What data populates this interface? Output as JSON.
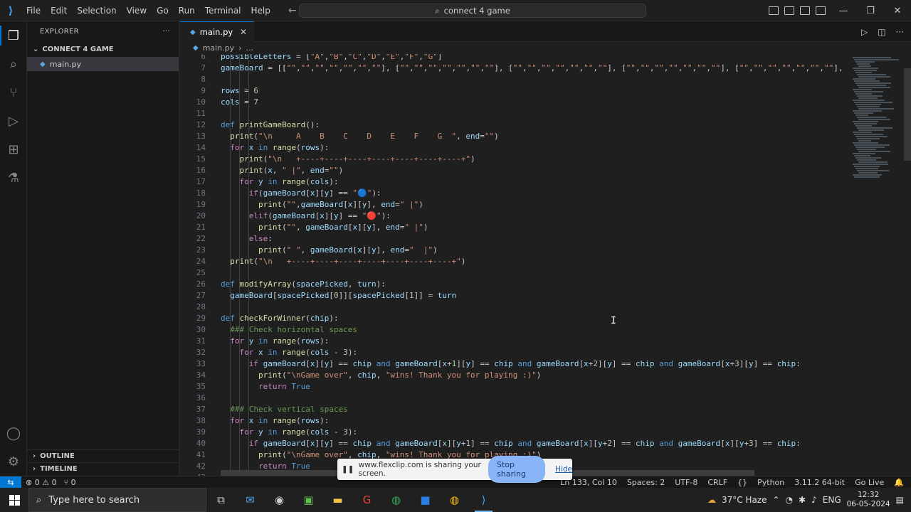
{
  "titlebar": {
    "menu": [
      "File",
      "Edit",
      "Selection",
      "View",
      "Go",
      "Run",
      "Terminal",
      "Help"
    ],
    "search_text": "connect 4 game"
  },
  "sidebar": {
    "title": "EXPLORER",
    "folder": "CONNECT 4 GAME",
    "file": "main.py",
    "outline": "OUTLINE",
    "timeline": "TIMELINE"
  },
  "tab": {
    "label": "main.py"
  },
  "breadcrumb": {
    "file": "main.py",
    "rest": "..."
  },
  "code_lines": [
    {
      "n": "6",
      "t": "possibleLetters = [\"A\",\"B\",\"C\",\"D\",\"E\",\"F\",\"G\"]"
    },
    {
      "n": "7",
      "t": "gameBoard = [[\"\",\"\",\"\",\"\",\"\",\"\",\"\"], [\"\",\"\",\"\",\"\",\"\",\"\",\"\"], [\"\",\"\",\"\",\"\",\"\",\"\",\"\"], [\"\",\"\",\"\",\"\",\"\",\"\",\"\"], [\"\",\"\",\"\",\"\",\"\",\"\",\"\"], [\"\","
    },
    {
      "n": "8",
      "t": ""
    },
    {
      "n": "9",
      "t": "rows = 6"
    },
    {
      "n": "10",
      "t": "cols = 7"
    },
    {
      "n": "11",
      "t": ""
    },
    {
      "n": "12",
      "t": "def printGameBoard():"
    },
    {
      "n": "13",
      "t": "  print(\"\\n     A    B    C    D    E    F    G  \", end=\"\")"
    },
    {
      "n": "14",
      "t": "  for x in range(rows):"
    },
    {
      "n": "15",
      "t": "    print(\"\\n   +----+----+----+----+----+----+----+\")"
    },
    {
      "n": "16",
      "t": "    print(x, \" |\", end=\"\")"
    },
    {
      "n": "17",
      "t": "    for y in range(cols):"
    },
    {
      "n": "18",
      "t": "      if(gameBoard[x][y] == \"🔵\"):"
    },
    {
      "n": "19",
      "t": "        print(\"\",gameBoard[x][y], end=\" |\")"
    },
    {
      "n": "20",
      "t": "      elif(gameBoard[x][y] == \"🔴\"):"
    },
    {
      "n": "21",
      "t": "        print(\"\", gameBoard[x][y], end=\" |\")"
    },
    {
      "n": "22",
      "t": "      else:"
    },
    {
      "n": "23",
      "t": "        print(\" \", gameBoard[x][y], end=\"  |\")"
    },
    {
      "n": "24",
      "t": "  print(\"\\n   +----+----+----+----+----+----+----+\")"
    },
    {
      "n": "25",
      "t": ""
    },
    {
      "n": "26",
      "t": "def modifyArray(spacePicked, turn):"
    },
    {
      "n": "27",
      "t": "  gameBoard[spacePicked[0]][spacePicked[1]] = turn"
    },
    {
      "n": "28",
      "t": ""
    },
    {
      "n": "29",
      "t": "def checkForWinner(chip):"
    },
    {
      "n": "30",
      "t": "  ### Check horizontal spaces"
    },
    {
      "n": "31",
      "t": "  for y in range(rows):"
    },
    {
      "n": "32",
      "t": "    for x in range(cols - 3):"
    },
    {
      "n": "33",
      "t": "      if gameBoard[x][y] == chip and gameBoard[x+1][y] == chip and gameBoard[x+2][y] == chip and gameBoard[x+3][y] == chip:"
    },
    {
      "n": "34",
      "t": "        print(\"\\nGame over\", chip, \"wins! Thank you for playing :)\")"
    },
    {
      "n": "35",
      "t": "        return True"
    },
    {
      "n": "36",
      "t": ""
    },
    {
      "n": "37",
      "t": "  ### Check vertical spaces"
    },
    {
      "n": "38",
      "t": "  for x in range(rows):"
    },
    {
      "n": "39",
      "t": "    for y in range(cols - 3):"
    },
    {
      "n": "40",
      "t": "      if gameBoard[x][y] == chip and gameBoard[x][y+1] == chip and gameBoard[x][y+2] == chip and gameBoard[x][y+3] == chip:"
    },
    {
      "n": "41",
      "t": "        print(\"\\nGame over\", chip, \"wins! Thank you for playing :)\")"
    },
    {
      "n": "42",
      "t": "        return True"
    },
    {
      "n": "43",
      "t": ""
    }
  ],
  "statusbar": {
    "problems": "⊗ 0 ⚠ 0",
    "ports": "⑂ 0",
    "position": "Ln 133, Col 10",
    "spaces": "Spaces: 2",
    "encoding": "UTF-8",
    "eol": "CRLF",
    "language": "Python",
    "interpreter": "3.11.2 64-bit",
    "golive": "Go Live"
  },
  "share": {
    "message": "www.flexclip.com is sharing your screen.",
    "stop": "Stop sharing",
    "hide": "Hide"
  },
  "taskbar": {
    "search_placeholder": "Type here to search",
    "weather": "37°C  Haze",
    "lang": "ENG",
    "time": "12:32",
    "date": "06-05-2024"
  }
}
